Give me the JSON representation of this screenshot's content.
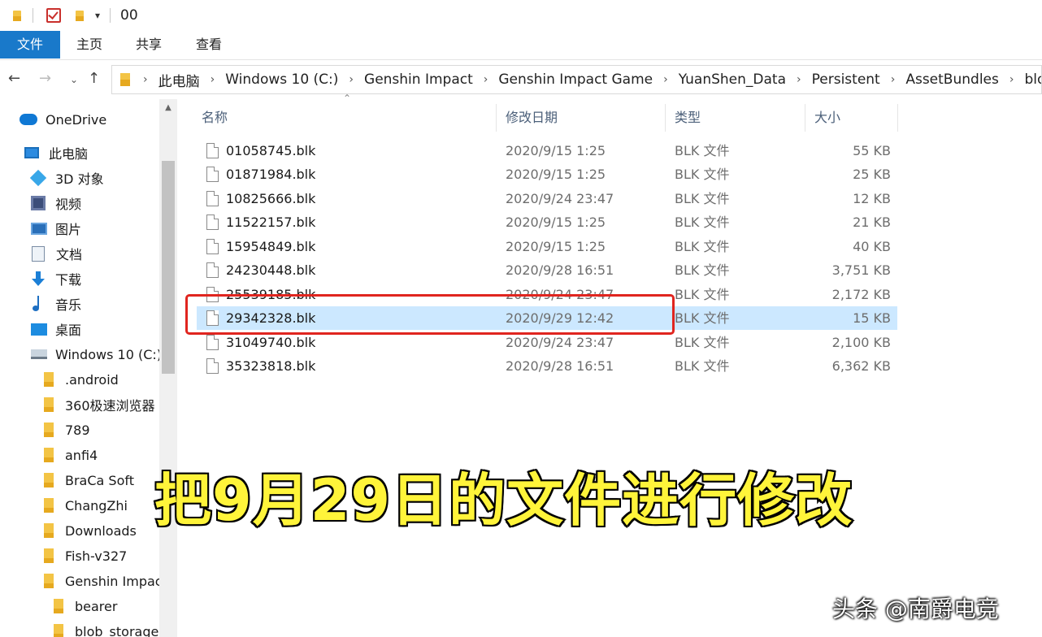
{
  "title_bar": {
    "quick_access_dropdown": "▾",
    "title": "00"
  },
  "ribbon": {
    "tabs": [
      "文件",
      "主页",
      "共享",
      "查看"
    ]
  },
  "nav": {
    "back": "←",
    "forward": "→",
    "recent": "⌄",
    "up": "↑",
    "breadcrumbs": [
      "此电脑",
      "Windows 10 (C:)",
      "Genshin Impact",
      "Genshin Impact Game",
      "YuanShen_Data",
      "Persistent",
      "AssetBundles",
      "blocks"
    ]
  },
  "sidebar": {
    "items": [
      {
        "label": "OneDrive",
        "icon": "cloud-icon"
      },
      {
        "label": "此电脑",
        "icon": "computer-icon"
      },
      {
        "label": "3D 对象",
        "icon": "3d-objects-icon"
      },
      {
        "label": "视频",
        "icon": "video-icon"
      },
      {
        "label": "图片",
        "icon": "pictures-icon"
      },
      {
        "label": "文档",
        "icon": "documents-icon"
      },
      {
        "label": "下载",
        "icon": "download-icon"
      },
      {
        "label": "音乐",
        "icon": "music-icon"
      },
      {
        "label": "桌面",
        "icon": "desktop-icon"
      },
      {
        "label": "Windows 10 (C:)",
        "icon": "drive-icon"
      },
      {
        "label": ".android",
        "icon": "folder-icon"
      },
      {
        "label": "360极速浏览器",
        "icon": "folder-icon"
      },
      {
        "label": "789",
        "icon": "folder-icon"
      },
      {
        "label": "anfi4",
        "icon": "folder-icon"
      },
      {
        "label": "BraCa Soft",
        "icon": "folder-icon"
      },
      {
        "label": "ChangZhi",
        "icon": "folder-icon"
      },
      {
        "label": "Downloads",
        "icon": "folder-icon"
      },
      {
        "label": "Fish-v327",
        "icon": "folder-icon"
      },
      {
        "label": "Genshin Impac",
        "icon": "folder-icon"
      },
      {
        "label": "bearer",
        "icon": "folder-icon"
      },
      {
        "label": "blob_storage",
        "icon": "folder-icon"
      }
    ]
  },
  "file_list": {
    "columns": {
      "name": "名称",
      "date": "修改日期",
      "type": "类型",
      "size": "大小"
    },
    "sort_indicator": "⌃",
    "rows": [
      {
        "name": "01058745.blk",
        "date": "2020/9/15 1:25",
        "type": "BLK 文件",
        "size": "55 KB"
      },
      {
        "name": "01871984.blk",
        "date": "2020/9/15 1:25",
        "type": "BLK 文件",
        "size": "25 KB"
      },
      {
        "name": "10825666.blk",
        "date": "2020/9/24 23:47",
        "type": "BLK 文件",
        "size": "12 KB"
      },
      {
        "name": "11522157.blk",
        "date": "2020/9/15 1:25",
        "type": "BLK 文件",
        "size": "21 KB"
      },
      {
        "name": "15954849.blk",
        "date": "2020/9/15 1:25",
        "type": "BLK 文件",
        "size": "40 KB"
      },
      {
        "name": "24230448.blk",
        "date": "2020/9/28 16:51",
        "type": "BLK 文件",
        "size": "3,751 KB"
      },
      {
        "name": "25539185.blk",
        "date": "2020/9/24 23:47",
        "type": "BLK 文件",
        "size": "2,172 KB"
      },
      {
        "name": "29342328.blk",
        "date": "2020/9/29 12:42",
        "type": "BLK 文件",
        "size": "15 KB"
      },
      {
        "name": "31049740.blk",
        "date": "2020/9/24 23:47",
        "type": "BLK 文件",
        "size": "2,100 KB"
      },
      {
        "name": "35323818.blk",
        "date": "2020/9/28 16:51",
        "type": "BLK 文件",
        "size": "6,362 KB"
      }
    ]
  },
  "overlay": {
    "caption": "把9月29日的文件进行修改",
    "watermark": "头条 @南爵电竞",
    "caption_color": "#fff43a",
    "highlight_color": "#e0251f"
  },
  "colors": {
    "accent": "#1979ca",
    "selection": "#cce8ff"
  }
}
